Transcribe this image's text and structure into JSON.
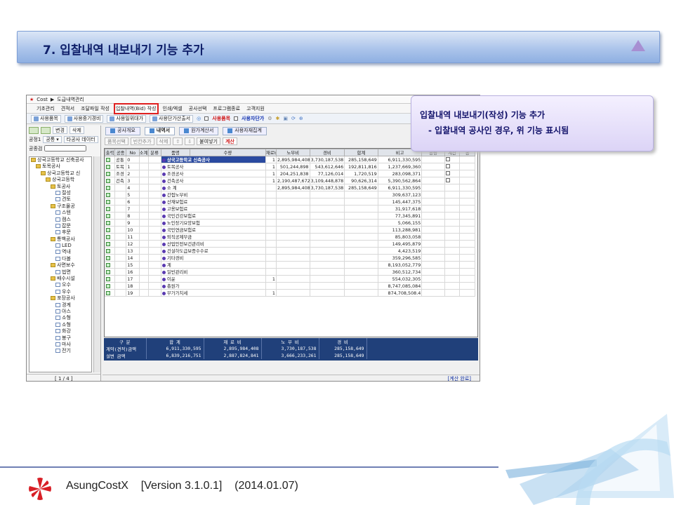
{
  "slide": {
    "title": "7. 입찰내역 내보내기 기능 추가"
  },
  "app": {
    "titlebar": {
      "app": "Cost",
      "path": "도급내역관리"
    },
    "menu": [
      "기초관리",
      "견적서",
      "조달파일 작성",
      "입찰내역(Bid) 작성",
      "인쇄/엑셀",
      "공사선택",
      "프로그램종료",
      "고객지원"
    ],
    "toolbar": {
      "items": [
        "사용품목",
        "사용중기경비",
        "사용일위대가",
        "사용단가산출서"
      ],
      "use_item": "사용품목",
      "user_price": "사용자단가"
    },
    "left": {
      "buttons": [
        "변경",
        "삭제"
      ],
      "filter_label": "공정1",
      "filter_value": "공통",
      "filter_other": "타공사 데이터",
      "search_label": "공종검",
      "pager": "[ 1 / 4 ]",
      "tree": [
        "상국고등학교 신축공사",
        "토목공사",
        "상국고등학교 신",
        "상국고등학",
        "토공사",
        "절성",
        "견토",
        "구조물공",
        "스텐",
        "캠스",
        "잡문",
        "후문",
        "통백공사",
        "LED",
        "역내",
        "다볼",
        "사면보수",
        "법면",
        "배수시설",
        "오수",
        "우수",
        "포장공사",
        "경계",
        "아스",
        "소형",
        "소형",
        "화강",
        "봉구",
        "마사",
        "전기"
      ]
    },
    "tabs": [
      "공사개요",
      "내역서",
      "원가계산서",
      "사용자재집계"
    ],
    "subtoolbar": [
      "품목선택",
      "빈칸추가",
      "삭제",
      "붙여넣기",
      "계산"
    ],
    "grid": {
      "headers": [
        "출력",
        "공종",
        "No",
        "소계",
        "분류",
        "품명",
        "수량",
        "재료비",
        "노무비",
        "경비",
        "합계",
        "비고",
        "공량",
        "계산",
        "공"
      ],
      "rows": [
        {
          "gong": "공통",
          "no": "0",
          "name": "상국고등학교 신축공사",
          "qty": "1",
          "mat": "2,895,984,408",
          "lab": "3,730,187,538",
          "exp": "285,158,649",
          "sum": "6,911,330,595",
          "hl": true
        },
        {
          "gong": "토목",
          "no": "1",
          "name": "토목공사",
          "qty": "1",
          "mat": "501,244,898",
          "lab": "543,612,646",
          "exp": "192,811,816",
          "sum": "1,237,669,360"
        },
        {
          "gong": "조경",
          "no": "2",
          "name": "조경공사",
          "qty": "1",
          "mat": "204,251,838",
          "lab": "77,126,014",
          "exp": "1,720,519",
          "sum": "283,098,371"
        },
        {
          "gong": "건축",
          "no": "3",
          "name": "건축공사",
          "qty": "1",
          "mat": "2,190,487,672",
          "lab": "3,109,448,878",
          "exp": "90,626,314",
          "sum": "5,390,562,864"
        },
        {
          "gong": "",
          "no": "4",
          "name": "소    계",
          "qty": "",
          "mat": "2,895,984,408",
          "lab": "3,730,187,538",
          "exp": "285,158,649",
          "sum": "6,911,330,595"
        },
        {
          "gong": "",
          "no": "5",
          "name": "간접노무비",
          "qty": "",
          "mat": "",
          "lab": "",
          "exp": "",
          "sum": "309,637,123"
        },
        {
          "gong": "",
          "no": "6",
          "name": "산재보험료",
          "qty": "",
          "mat": "",
          "lab": "",
          "exp": "",
          "sum": "145,447,375"
        },
        {
          "gong": "",
          "no": "7",
          "name": "고용보험료",
          "qty": "",
          "mat": "",
          "lab": "",
          "exp": "",
          "sum": "31,917,618"
        },
        {
          "gong": "",
          "no": "8",
          "name": "국민건강보험료",
          "qty": "",
          "mat": "",
          "lab": "",
          "exp": "",
          "sum": "77,345,891"
        },
        {
          "gong": "",
          "no": "9",
          "name": "노인장기요양보험",
          "qty": "",
          "mat": "",
          "lab": "",
          "exp": "",
          "sum": "5,066,155"
        },
        {
          "gong": "",
          "no": "10",
          "name": "국민연금보험료",
          "qty": "",
          "mat": "",
          "lab": "",
          "exp": "",
          "sum": "113,288,981"
        },
        {
          "gong": "",
          "no": "11",
          "name": "퇴직공제부금",
          "qty": "",
          "mat": "",
          "lab": "",
          "exp": "",
          "sum": "85,803,058"
        },
        {
          "gong": "",
          "no": "12",
          "name": "산업안전보건관리비",
          "qty": "",
          "mat": "",
          "lab": "",
          "exp": "",
          "sum": "149,495,879"
        },
        {
          "gong": "",
          "no": "13",
          "name": "건설하도급보증수수료",
          "qty": "",
          "mat": "",
          "lab": "",
          "exp": "",
          "sum": "4,423,519"
        },
        {
          "gong": "",
          "no": "14",
          "name": "기타경비",
          "qty": "",
          "mat": "",
          "lab": "",
          "exp": "",
          "sum": "359,296,585"
        },
        {
          "gong": "",
          "no": "15",
          "name": "계",
          "qty": "",
          "mat": "",
          "lab": "",
          "exp": "",
          "sum": "8,193,052,779"
        },
        {
          "gong": "",
          "no": "16",
          "name": "일반관리비",
          "qty": "",
          "mat": "",
          "lab": "",
          "exp": "",
          "sum": "360,512,734"
        },
        {
          "gong": "",
          "no": "17",
          "name": "이윤",
          "qty": "1",
          "mat": "",
          "lab": "",
          "exp": "",
          "sum": "554,032,305"
        },
        {
          "gong": "",
          "no": "18",
          "name": "총원가",
          "qty": "",
          "mat": "",
          "lab": "",
          "exp": "",
          "sum": "8,747,085,084"
        },
        {
          "gong": "",
          "no": "19",
          "name": "부가가치세",
          "qty": "1",
          "mat": "",
          "lab": "",
          "exp": "",
          "sum": "874,708,508.4"
        }
      ]
    },
    "summary": {
      "headers": [
        "구    분",
        "합    계",
        "재 료 비",
        "노 무 비",
        "경    비"
      ],
      "rows": [
        [
          "계약(견적)금액",
          "6,911,330,595",
          "2,895,984,408",
          "3,730,187,538",
          "285,158,649"
        ],
        [
          "설변    금액",
          "6,839,216,751",
          "2,887,824,841",
          "3,666,233,261",
          "285,158,649"
        ]
      ]
    },
    "status": "[계산 완료]"
  },
  "callout": {
    "line1": "입찰내역 내보내기(작성) 기능 추가",
    "line2": "- 입찰내역 공사인 경우, 위 기능 표시됨"
  },
  "footer": {
    "product": "AsungCostX",
    "version": "[Version 3.1.0.1]",
    "date": "(2014.01.07)"
  }
}
